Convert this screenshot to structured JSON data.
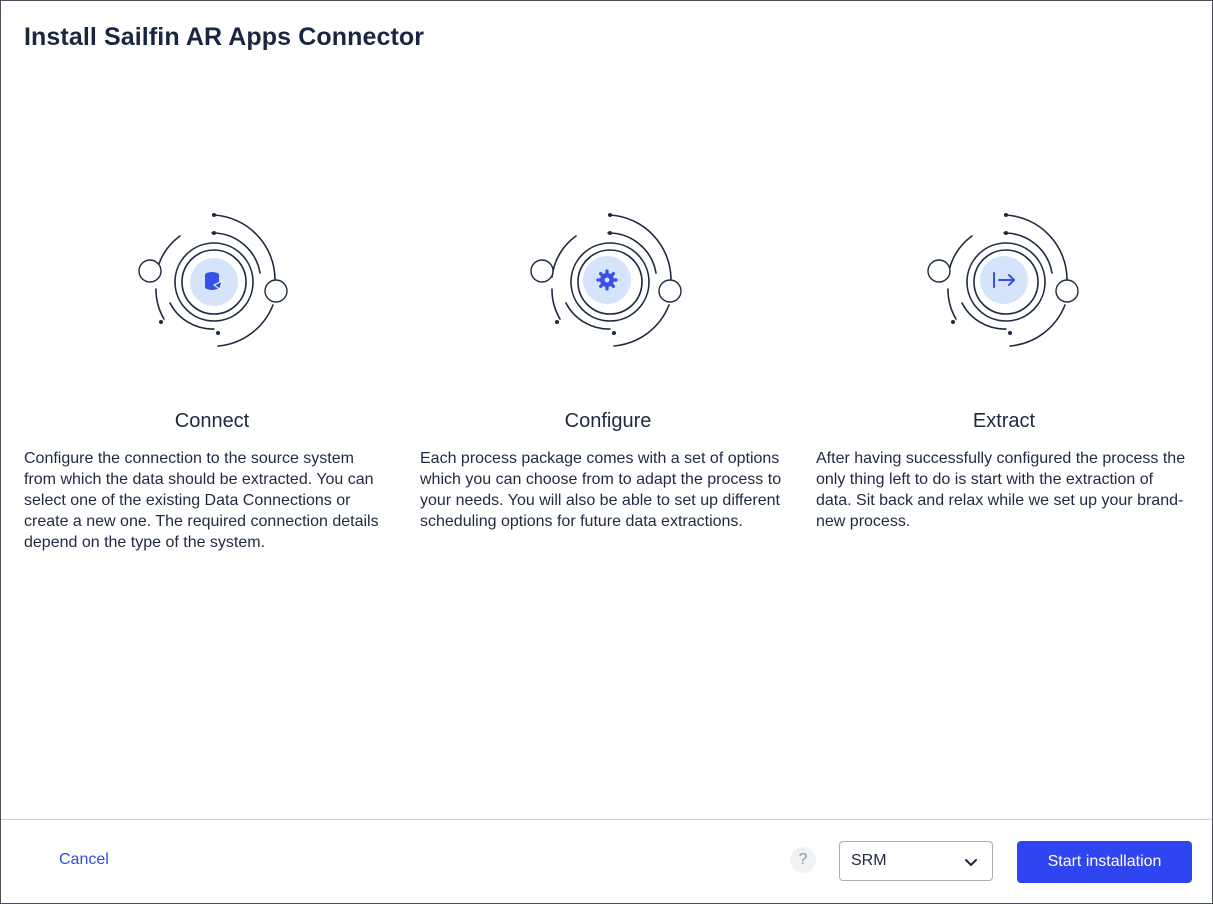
{
  "dialog": {
    "title": "Install Sailfin AR Apps Connector"
  },
  "steps": [
    {
      "title": "Connect",
      "icon": "database-plug-icon",
      "description": "Configure the connection to the source system from which the data should be extracted. You can select one of the existing Data Connections or create a new one. The required connection details depend on the type of the system."
    },
    {
      "title": "Configure",
      "icon": "gear-icon",
      "description": "Each process package comes with a set of options which you can choose from to adapt the process to your needs. You will also be able to set up different scheduling options for future data extractions."
    },
    {
      "title": "Extract",
      "icon": "arrow-right-to-bar-icon",
      "description": "After having successfully configured the process the only thing left to do is start with the extraction of data. Sit back and relax while we set up your brand-new process."
    }
  ],
  "footer": {
    "cancel_label": "Cancel",
    "help_label": "?",
    "system_select": {
      "value": "SRM"
    },
    "start_label": "Start installation"
  },
  "colors": {
    "accent": "#2f45ef",
    "icon_fill": "#3650e8",
    "icon_bg": "#d6e4fb",
    "title_text": "#182641",
    "link": "#2f4fe6",
    "orbit_stroke": "#1e2a40"
  }
}
